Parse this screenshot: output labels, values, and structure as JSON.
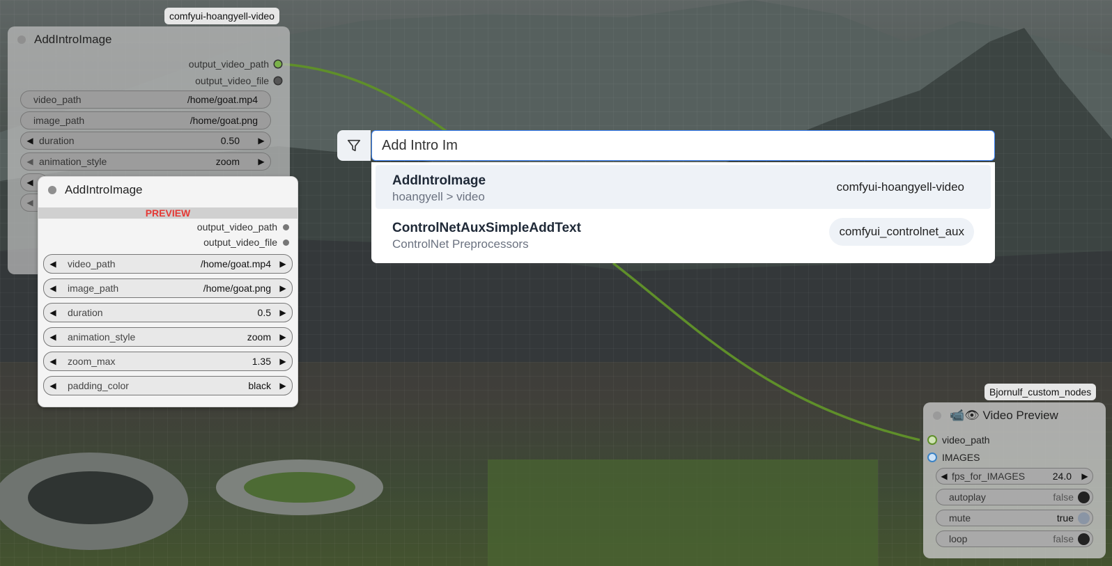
{
  "colors": {
    "link_green": "#5f8f2a",
    "accent_blue": "#3b82f6",
    "preview_red": "#e53935"
  },
  "node_background": {
    "badge": "comfyui-hoangyell-video",
    "title": "AddIntroImage",
    "outputs": [
      "output_video_path",
      "output_video_file"
    ],
    "widgets": [
      {
        "label": "video_path",
        "value": "/home/goat.mp4"
      },
      {
        "label": "image_path",
        "value": "/home/goat.png"
      },
      {
        "label": "duration",
        "value": "0.50"
      },
      {
        "label": "animation_style",
        "value": "zoom"
      }
    ]
  },
  "node_preview": {
    "title": "AddIntroImage",
    "preview_label": "PREVIEW",
    "outputs": [
      "output_video_path",
      "output_video_file"
    ],
    "widgets": [
      {
        "label": "video_path",
        "value": "/home/goat.mp4"
      },
      {
        "label": "image_path",
        "value": "/home/goat.png"
      },
      {
        "label": "duration",
        "value": "0.5"
      },
      {
        "label": "animation_style",
        "value": "zoom"
      },
      {
        "label": "zoom_max",
        "value": "1.35"
      },
      {
        "label": "padding_color",
        "value": "black"
      }
    ]
  },
  "search": {
    "filter_icon": "filter-icon",
    "query": "Add Intro Im",
    "results": [
      {
        "name": "AddIntroImage",
        "category": "hoangyell > video",
        "package": "comfyui-hoangyell-video"
      },
      {
        "name": "ControlNetAuxSimpleAddText",
        "category": "ControlNet Preprocessors",
        "package": "comfyui_controlnet_aux"
      }
    ]
  },
  "node_video_preview": {
    "badge": "Bjornulf_custom_nodes",
    "title": "📹👁 Video Preview",
    "inputs": [
      "video_path",
      "IMAGES"
    ],
    "fps": {
      "label": "fps_for_IMAGES",
      "value": "24.0"
    },
    "toggles": [
      {
        "label": "autoplay",
        "value": "false",
        "on": false
      },
      {
        "label": "mute",
        "value": "true",
        "on": true
      },
      {
        "label": "loop",
        "value": "false",
        "on": false
      }
    ]
  }
}
